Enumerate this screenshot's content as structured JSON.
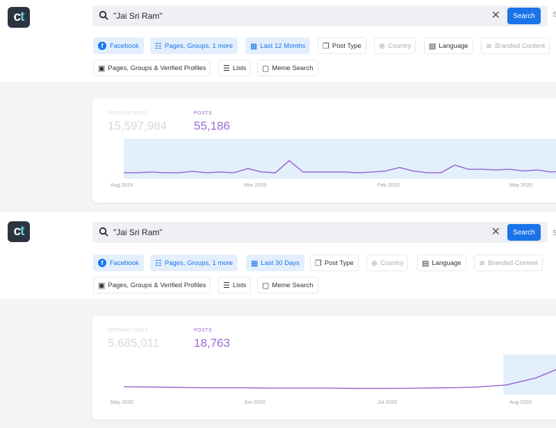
{
  "screens": [
    {
      "logo": {
        "c": "c",
        "t": "t"
      },
      "search": {
        "query": "\"Jai Sri Ram\"",
        "button": "Search",
        "more": "S"
      },
      "filters_row1": {
        "facebook": "Facebook",
        "pages_groups": "Pages, Groups, 1 more",
        "timeframe": "Last 12 Months",
        "post_type": "Post Type",
        "country": "Country",
        "language": "Language",
        "branded": "Branded Content"
      },
      "filters_row2": {
        "profiles": "Pages, Groups & Verified Profiles",
        "lists": "Lists",
        "meme": "Meme Search"
      },
      "stats": {
        "interactions_label": "INTERACTIONS",
        "interactions_value": "15,597,984",
        "posts_label": "POSTS",
        "posts_value": "55,186"
      },
      "chart_data": {
        "type": "line",
        "x_labels": [
          "Aug 2019",
          "Nov 2019",
          "Feb 2020",
          "May 2020"
        ],
        "series": [
          {
            "values": [
              0.1,
              0.1,
              0.12,
              0.1,
              0.1,
              0.14,
              0.1,
              0.12,
              0.1,
              0.22,
              0.12,
              0.1,
              0.45,
              0.12,
              0.12,
              0.12,
              0.12,
              0.1,
              0.12,
              0.15,
              0.25,
              0.15,
              0.1,
              0.1,
              0.32,
              0.2,
              0.2,
              0.18,
              0.2,
              0.15,
              0.18,
              0.12,
              0.15
            ]
          }
        ],
        "highlight": "full range",
        "grid": false
      }
    },
    {
      "logo": {
        "c": "c",
        "t": "t"
      },
      "search": {
        "query": "\"Jai Sri Ram\"",
        "button": "Search",
        "more": "S"
      },
      "filters_row1": {
        "facebook": "Facebook",
        "pages_groups": "Pages, Groups, 1 more",
        "timeframe": "Last 30 Days",
        "post_type": "Post Type",
        "country": "Country",
        "language": "Language",
        "branded": "Branded Content"
      },
      "filters_row2": {
        "profiles": "Pages, Groups & Verified Profiles",
        "lists": "Lists",
        "meme": "Meme Search"
      },
      "stats": {
        "interactions_label": "INTERACTIONS",
        "interactions_value": "5,685,011",
        "posts_label": "POSTS",
        "posts_value": "18,763"
      },
      "chart_data": {
        "type": "line",
        "x_labels": [
          "May 2020",
          "Jun 2020",
          "Jul 2020",
          "Aug 2020"
        ],
        "series": [
          {
            "values": [
              0.15,
              0.14,
              0.13,
              0.12,
              0.12,
              0.11,
              0.11,
              0.11,
              0.1,
              0.1,
              0.11,
              0.12,
              0.14,
              0.2,
              0.4,
              0.75
            ]
          }
        ],
        "highlight": "last 30 days",
        "grid": false
      }
    }
  ],
  "colors": {
    "accent": "#1a73e8",
    "posts": "#9b6ad6",
    "highlight": "#e3f0fc"
  }
}
